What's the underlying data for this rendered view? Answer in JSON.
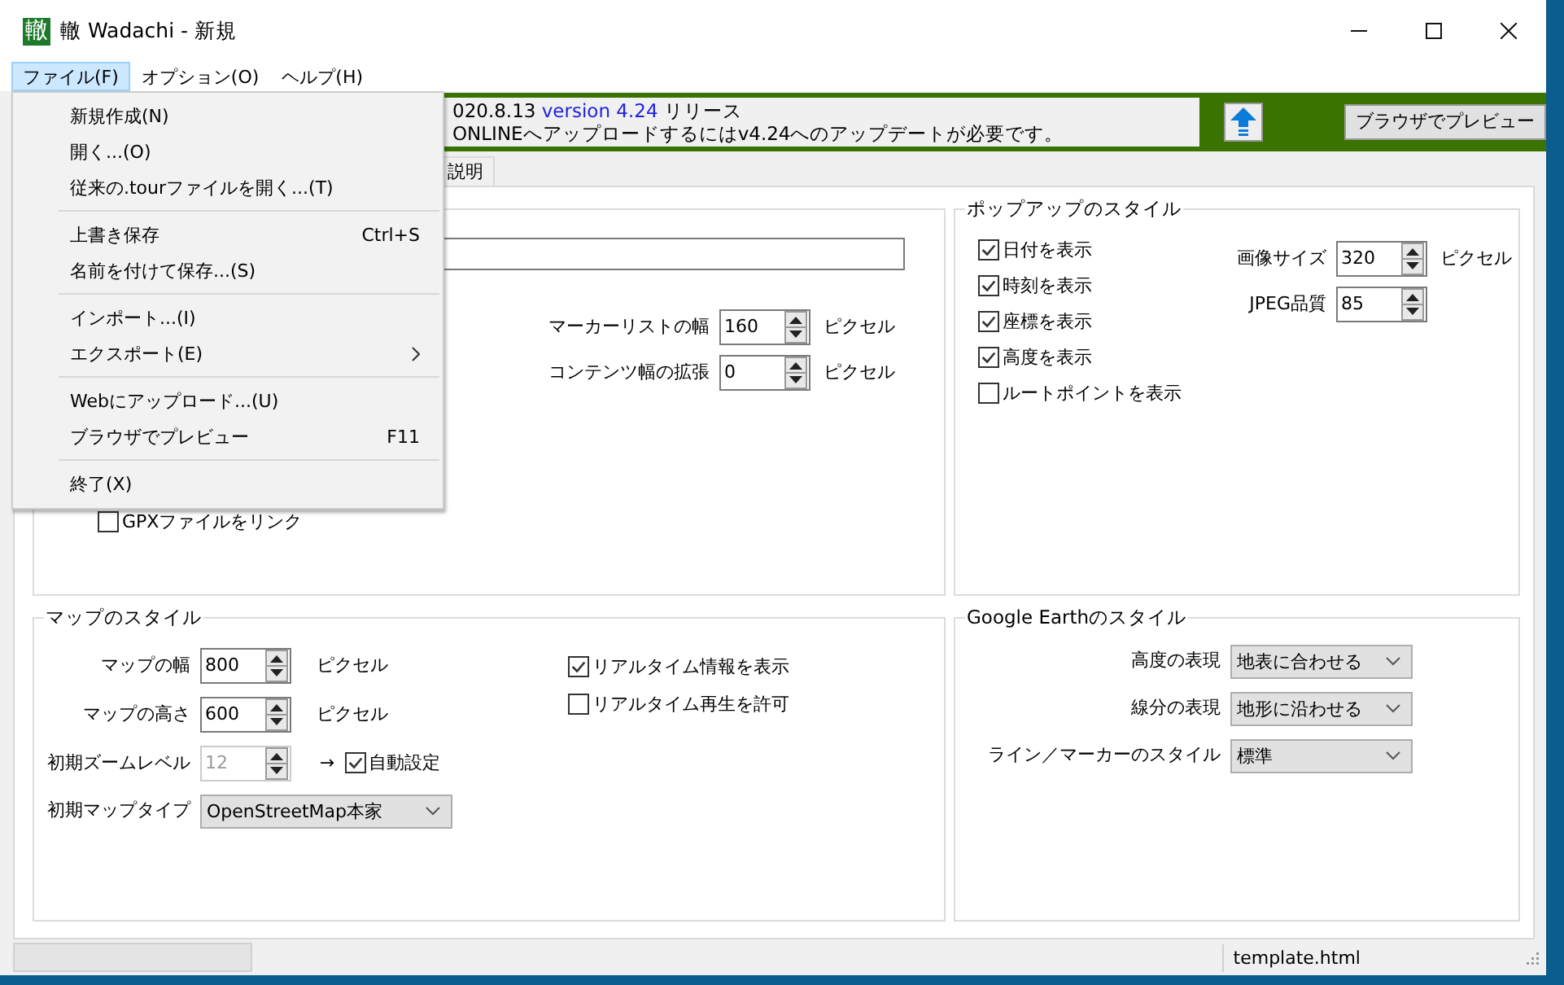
{
  "window": {
    "title": "轍 Wadachi - 新規",
    "icon_glyph": "轍"
  },
  "menu_bar": [
    {
      "label": "ファイル(F)",
      "selected": true
    },
    {
      "label": "オプション(O)",
      "selected": false
    },
    {
      "label": "ヘルプ(H)",
      "selected": false
    }
  ],
  "file_menu": [
    {
      "kind": "item",
      "label": "新規作成(N)"
    },
    {
      "kind": "item",
      "label": "開く...(O)"
    },
    {
      "kind": "item",
      "label": "従来の.tourファイルを開く...(T)"
    },
    {
      "kind": "separator"
    },
    {
      "kind": "item",
      "label": "上書き保存",
      "shortcut": "Ctrl+S"
    },
    {
      "kind": "item",
      "label": "名前を付けて保存...(S)"
    },
    {
      "kind": "separator"
    },
    {
      "kind": "item",
      "label": "インポート...(I)"
    },
    {
      "kind": "submenu",
      "label": "エクスポート(E)"
    },
    {
      "kind": "separator"
    },
    {
      "kind": "item",
      "label": "Webにアップロード...(U)"
    },
    {
      "kind": "item",
      "label": "ブラウザでプレビュー",
      "shortcut": "F11"
    },
    {
      "kind": "separator"
    },
    {
      "kind": "item",
      "label": "終了(X)"
    }
  ],
  "banner": {
    "date": "020.8.13",
    "version": "version 4.24",
    "release": "リリース",
    "message": "ONLINEへアップロードするにはv4.24へのアップデートが必要です。",
    "preview_button": "ブラウザでプレビュー"
  },
  "tabs": [
    {
      "label": "説明",
      "selected": false
    }
  ],
  "general": {
    "spinners": [
      {
        "label": "マーカーリストの幅",
        "value": "160",
        "unit": "ピクセル"
      },
      {
        "label": "コンテンツ幅の拡張",
        "value": "0",
        "unit": "ピクセル"
      }
    ],
    "checkboxes": [
      {
        "label": "GPXファイルをリンク",
        "checked": false
      }
    ]
  },
  "popup_style": {
    "title": "ポップアップのスタイル",
    "checkboxes": [
      {
        "label": "日付を表示",
        "checked": true
      },
      {
        "label": "時刻を表示",
        "checked": true
      },
      {
        "label": "座標を表示",
        "checked": true
      },
      {
        "label": "高度を表示",
        "checked": true
      },
      {
        "label": "ルートポイントを表示",
        "checked": false
      }
    ],
    "spinners": [
      {
        "label": "画像サイズ",
        "value": "320",
        "unit": "ピクセル"
      },
      {
        "label": "JPEG品質",
        "value": "85"
      }
    ]
  },
  "map_style": {
    "title": "マップのスタイル",
    "spinners": [
      {
        "label": "マップの幅",
        "value": "800",
        "unit": "ピクセル",
        "disabled": false
      },
      {
        "label": "マップの高さ",
        "value": "600",
        "unit": "ピクセル",
        "disabled": false
      },
      {
        "label": "初期ズームレベル",
        "value": "12",
        "disabled": true,
        "arrow": "→",
        "auto": {
          "label": "自動設定",
          "checked": true
        }
      }
    ],
    "map_type": {
      "label": "初期マップタイプ",
      "value": "OpenStreetMap本家"
    },
    "checkboxes": [
      {
        "label": "リアルタイム情報を表示",
        "checked": true
      },
      {
        "label": "リアルタイム再生を許可",
        "checked": false
      }
    ]
  },
  "google_earth_style": {
    "title": "Google Earthのスタイル",
    "selects": [
      {
        "label": "高度の表現",
        "value": "地表に合わせる"
      },
      {
        "label": "線分の表現",
        "value": "地形に沿わせる"
      },
      {
        "label": "ライン／マーカーのスタイル",
        "value": "標準"
      }
    ]
  },
  "status_bar": {
    "file": "template.html"
  }
}
